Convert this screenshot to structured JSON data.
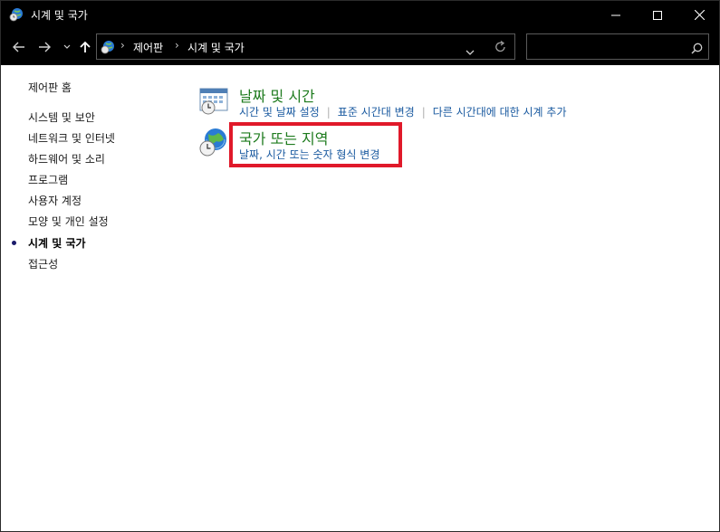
{
  "window": {
    "title": "시계 및 국가",
    "controls": {
      "minimize": "minimize",
      "maximize": "maximize",
      "close": "close"
    }
  },
  "address_bar": {
    "breadcrumbs": [
      "제어판",
      "시계 및 국가"
    ],
    "search_placeholder": ""
  },
  "sidebar": {
    "home": "제어판 홈",
    "items": [
      {
        "label": "시스템 및 보안",
        "active": false
      },
      {
        "label": "네트워크 및 인터넷",
        "active": false
      },
      {
        "label": "하드웨어 및 소리",
        "active": false
      },
      {
        "label": "프로그램",
        "active": false
      },
      {
        "label": "사용자 계정",
        "active": false
      },
      {
        "label": "모양 및 개인 설정",
        "active": false
      },
      {
        "label": "시계 및 국가",
        "active": true
      },
      {
        "label": "접근성",
        "active": false
      }
    ]
  },
  "categories": [
    {
      "title": "날짜 및 시간",
      "icon": "calendar-clock-icon",
      "links": [
        "시간 및 날짜 설정",
        "표준 시간대 변경",
        "다른 시간대에 대한 시계 추가"
      ]
    },
    {
      "title": "국가 또는 지역",
      "icon": "globe-clock-icon",
      "links": [
        "날짜, 시간 또는 숫자 형식 변경"
      ],
      "highlighted": true
    }
  ],
  "colors": {
    "titlebar": "#000000",
    "category_title": "#1e7b1e",
    "link": "#1a5aa0",
    "highlight_border": "#e0192a"
  }
}
